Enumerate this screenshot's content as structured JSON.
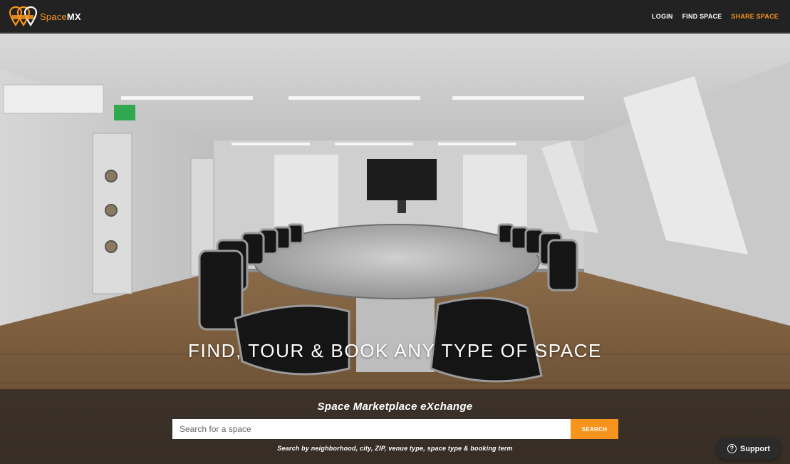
{
  "brand": {
    "name_prefix": "Space",
    "name_suffix": "MX",
    "icon_name": "map-pin-logo-icon",
    "accent_color": "#f7941d"
  },
  "nav": {
    "login": "LOGIN",
    "find_space": "FIND SPACE",
    "share_space": "SHARE SPACE"
  },
  "hero": {
    "headline": "FIND, TOUR & BOOK ANY TYPE OF SPACE",
    "image_subject": "conference room with long oval table and black office chairs"
  },
  "search": {
    "tagline": "Space Marketplace eXchange",
    "placeholder": "Search for a space",
    "button_label": "SEARCH",
    "helper": "Search by neighborhood, city, ZIP, venue type, space type & booking term"
  },
  "support": {
    "label": "Support",
    "icon_name": "question-circle-icon"
  }
}
